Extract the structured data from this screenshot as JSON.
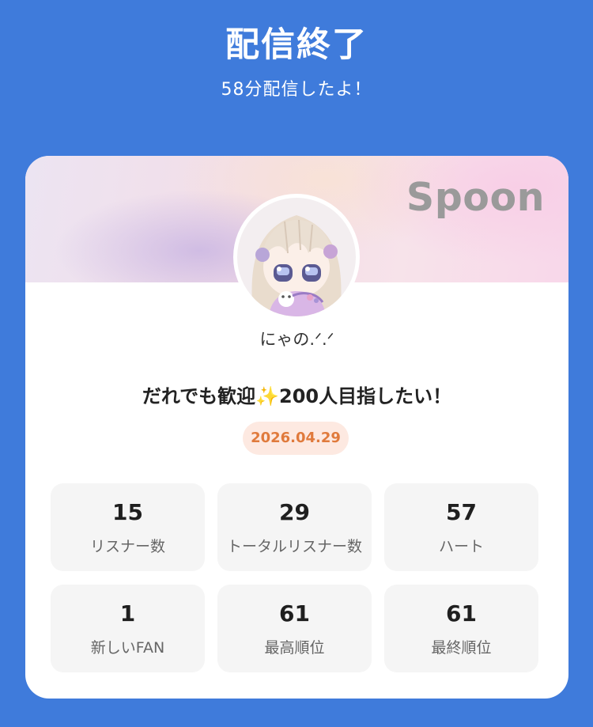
{
  "header": {
    "title": "配信終了",
    "subtitle": "58分配信したよ！"
  },
  "card": {
    "brand": "Spoon",
    "username": "にゃの.ᐟ.ᐟ",
    "live_title": "だれでも歓迎✨200人目指したい！",
    "date": "2026.04.29",
    "stats": [
      {
        "value": "15",
        "label": "リスナー数"
      },
      {
        "value": "29",
        "label": "トータルリスナー数"
      },
      {
        "value": "57",
        "label": "ハート"
      },
      {
        "value": "1",
        "label": "新しいFAN"
      },
      {
        "value": "61",
        "label": "最高順位"
      },
      {
        "value": "61",
        "label": "最終順位"
      }
    ]
  },
  "colors": {
    "background": "#3f7bdb",
    "card": "#ffffff",
    "stat_tile": "#f5f5f5",
    "date_badge_bg": "#fde9e1",
    "date_badge_text": "#e07a3c",
    "brand": "#9a9a9a"
  },
  "icons": {
    "avatar": "avatar-illustration"
  }
}
